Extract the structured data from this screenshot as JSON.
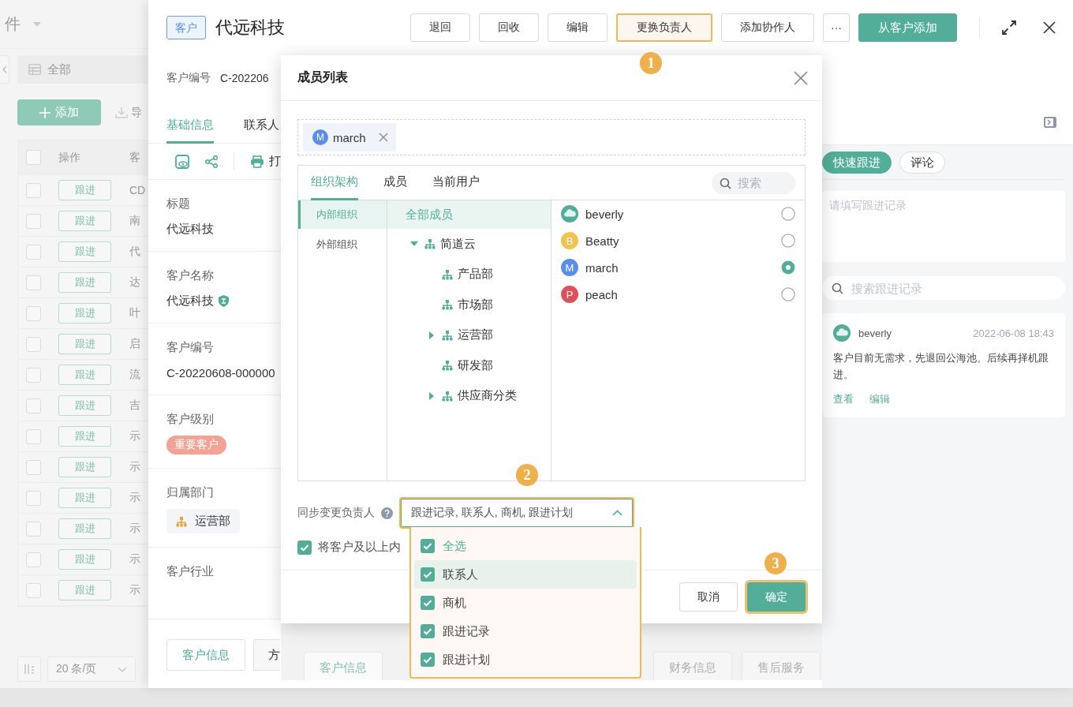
{
  "list_page": {
    "title": "件",
    "view": "全部",
    "add_button": "添加",
    "import_button": "导",
    "all_checked": false,
    "columns": [
      "操作",
      "客"
    ],
    "rows": [
      {
        "checked": false,
        "action": "跟进",
        "column_3": "CD"
      },
      {
        "checked": false,
        "action": "跟进",
        "column_3": "南"
      },
      {
        "checked": false,
        "action": "跟进",
        "column_3": "代"
      },
      {
        "checked": false,
        "action": "跟进",
        "column_3": "达"
      },
      {
        "checked": false,
        "action": "跟进",
        "column_3": "叶"
      },
      {
        "checked": false,
        "action": "跟进",
        "column_3": "启"
      },
      {
        "checked": false,
        "action": "跟进",
        "column_3": "流"
      },
      {
        "checked": false,
        "action": "跟进",
        "column_3": "吉"
      },
      {
        "checked": false,
        "action": "跟进",
        "column_3": "示"
      },
      {
        "checked": false,
        "action": "跟进",
        "column_3": "示"
      },
      {
        "checked": false,
        "action": "跟进",
        "column_3": "示"
      },
      {
        "checked": false,
        "action": "跟进",
        "column_3": "示"
      },
      {
        "checked": false,
        "action": "跟进",
        "column_3": "示"
      },
      {
        "checked": false,
        "action": "跟进",
        "column_3": "示"
      }
    ],
    "page_size": "20 条/页"
  },
  "drawer": {
    "tag": "客户",
    "title": "代远科技",
    "actions": [
      {
        "label": "退回",
        "kind": "plain",
        "highlighted": false
      },
      {
        "label": "回收",
        "kind": "plain",
        "highlighted": false
      },
      {
        "label": "编辑",
        "kind": "plain",
        "highlighted": false
      },
      {
        "label": "更换负责人",
        "kind": "plain",
        "highlighted": true
      },
      {
        "label": "添加协作人",
        "kind": "plain",
        "highlighted": false
      },
      {
        "label": "···",
        "kind": "more",
        "highlighted": false
      },
      {
        "label": "从客户添加",
        "kind": "primary",
        "highlighted": false
      }
    ],
    "code_label": "客户编号",
    "code_value": "C-202206",
    "tabs": [
      {
        "label": "基础信息",
        "selected": true
      },
      {
        "label": "联系人",
        "selected": false
      }
    ],
    "print_label": "打",
    "fields": [
      {
        "label": "标题",
        "value": "代远科技",
        "kind": "text"
      },
      {
        "label": "客户名称",
        "value": "代远科技",
        "kind": "verified"
      },
      {
        "label": "客户编号",
        "value": "C-20220608-000000",
        "kind": "text"
      },
      {
        "label": "客户级别",
        "value": "重要客户",
        "kind": "tag"
      },
      {
        "label": "归属部门",
        "value": "运营部",
        "kind": "department"
      },
      {
        "label": "客户行业",
        "kind": "empty"
      }
    ],
    "bottom_tabs": [
      {
        "label": "客户信息",
        "selected": true
      },
      {
        "label": "方",
        "selected": false
      }
    ]
  },
  "follow_panel": {
    "tabs": [
      {
        "label": "快速跟进",
        "selected": true
      },
      {
        "label": "评论",
        "selected": false
      }
    ],
    "note_placeholder": "请填写跟进记录",
    "search_placeholder": "搜索跟进记录",
    "records": [
      {
        "author": "beverly",
        "time": "2022-06-08 18:43",
        "text": "客户目前无需求，先退回公海池。后续再择机跟进。",
        "links": [
          "查看",
          "编辑"
        ]
      }
    ]
  },
  "modal": {
    "title": "成员列表",
    "chosen": [
      {
        "initial": "M",
        "name": "march",
        "color": "#5b8def"
      }
    ],
    "tabs": [
      {
        "label": "组织架构",
        "selected": true
      },
      {
        "label": "成员",
        "selected": false
      },
      {
        "label": "当前用户",
        "selected": false
      }
    ],
    "search_placeholder": "搜索",
    "org_groups": [
      {
        "label": "内部组织",
        "selected": true
      },
      {
        "label": "外部组织",
        "selected": false
      }
    ],
    "all_members": {
      "label": "全部成员",
      "selected": true
    },
    "tree": [
      {
        "label": "简道云",
        "kind": "group",
        "expanded": true,
        "selected": false,
        "children": [
          {
            "label": "产品部",
            "kind": "leaf",
            "selected": false
          },
          {
            "label": "市场部",
            "kind": "leaf",
            "selected": false
          },
          {
            "label": "运营部",
            "kind": "group",
            "expanded": false,
            "selected": false
          },
          {
            "label": "研发部",
            "kind": "leaf",
            "selected": false
          },
          {
            "label": "供应商分类",
            "kind": "group",
            "expanded": false,
            "selected": false
          }
        ]
      }
    ],
    "members": [
      {
        "name": "beverly",
        "kind": "logo",
        "color": "#4fae97",
        "selected": false
      },
      {
        "name": "Beatty",
        "kind": "initial",
        "initial": "B",
        "color": "#f1c24d",
        "selected": false
      },
      {
        "name": "march",
        "kind": "initial",
        "initial": "M",
        "color": "#5b8def",
        "selected": true
      },
      {
        "name": "peach",
        "kind": "initial",
        "initial": "P",
        "color": "#e0505a",
        "selected": false
      }
    ],
    "sync": {
      "label": "同步变更负责人",
      "value": "跟进记录, 联系人, 商机, 跟进计划",
      "open": true,
      "highlighted": true,
      "options": [
        {
          "label": "全选",
          "kind": "all",
          "checked": true,
          "hovered": false
        },
        {
          "label": "联系人",
          "kind": "item",
          "checked": true,
          "hovered": true
        },
        {
          "label": "商机",
          "kind": "item",
          "checked": true,
          "hovered": false
        },
        {
          "label": "跟进记录",
          "kind": "item",
          "checked": true,
          "hovered": false
        },
        {
          "label": "跟进计划",
          "kind": "item",
          "checked": true,
          "hovered": false
        }
      ]
    },
    "include": {
      "label": "将客户及以上内",
      "checked": true
    },
    "buttons": [
      {
        "label": "取消",
        "kind": "plain",
        "highlighted": false
      },
      {
        "label": "确定",
        "kind": "primary",
        "highlighted": true
      }
    ]
  },
  "background_tabs": [
    {
      "label": "客户信息",
      "selected": true
    },
    {
      "label": "财务信息",
      "selected": false
    },
    {
      "label": "售后服务",
      "selected": false
    }
  ],
  "callouts": [
    "1",
    "2",
    "3"
  ]
}
